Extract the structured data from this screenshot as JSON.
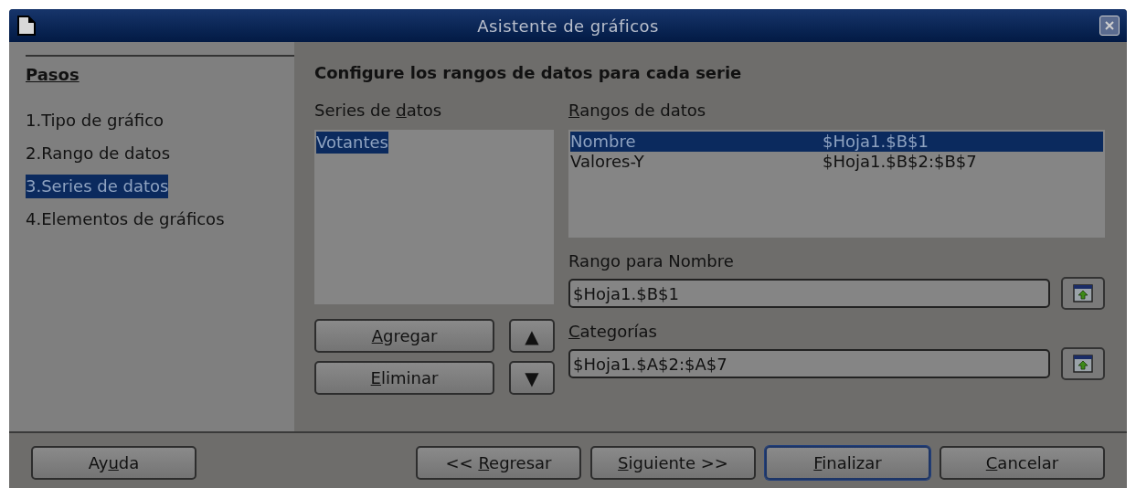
{
  "window": {
    "title": "Asistente de gráficos"
  },
  "steps": {
    "heading": "Pasos",
    "items": [
      {
        "label": "1.Tipo de gráfico",
        "selected": false
      },
      {
        "label": "2.Rango de datos",
        "selected": false
      },
      {
        "label": "3.Series de datos",
        "selected": true
      },
      {
        "label": "4.Elementos de gráficos",
        "selected": false
      }
    ]
  },
  "heading": "Configure los rangos de datos para cada serie",
  "series": {
    "label": {
      "pre": "Series de ",
      "key": "d",
      "post": "atos"
    },
    "items": [
      {
        "label": "Votantes",
        "selected": true
      }
    ]
  },
  "series_buttons": [
    {
      "key": "A",
      "post": "gregar"
    },
    {
      "key": "E",
      "post": "liminar"
    }
  ],
  "move_buttons": [
    {
      "glyph": "▲"
    },
    {
      "glyph": "▼"
    }
  ],
  "ranges": {
    "label": {
      "key": "R",
      "post": "angos de datos"
    },
    "rows": [
      {
        "role": "Nombre",
        "range": "$Hoja1.$B$1",
        "selected": true
      },
      {
        "role": "Valores-Y",
        "range": "$Hoja1.$B$2:$B$7",
        "selected": false
      }
    ]
  },
  "fields": [
    {
      "label": {
        "pre": "Ran",
        "key": "g",
        "post": "o para Nombre"
      },
      "value": "$Hoja1.$B$1"
    },
    {
      "label": {
        "key": "C",
        "post": "ategorías"
      },
      "value": "$Hoja1.$A$2:$A$7"
    }
  ],
  "footer_buttons": [
    {
      "pre": "Ay",
      "key": "u",
      "post": "da",
      "default": false
    },
    {
      "pre": "<< ",
      "key": "R",
      "post": "egresar",
      "default": false
    },
    {
      "key": "S",
      "post": "iguiente >>",
      "default": false
    },
    {
      "key": "F",
      "post": "inalizar",
      "default": true
    },
    {
      "key": "C",
      "post": "ancelar",
      "default": false
    }
  ]
}
